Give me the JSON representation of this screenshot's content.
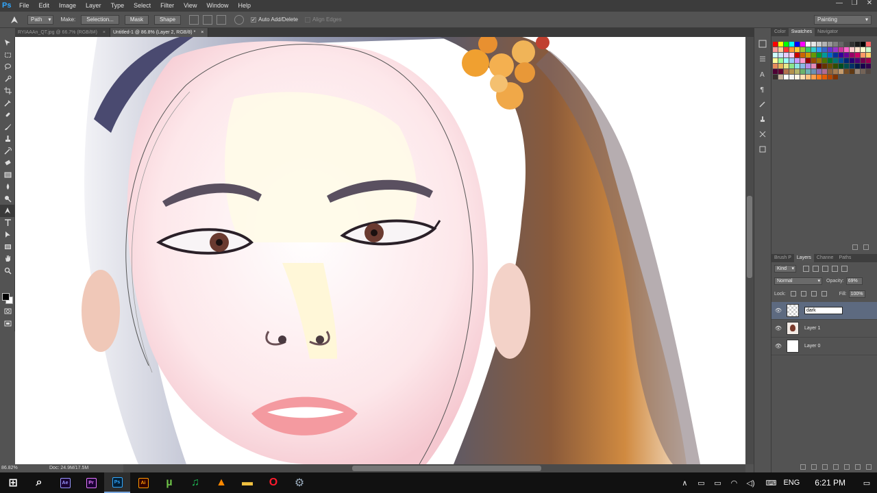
{
  "menu": {
    "logo": "Ps",
    "items": [
      "File",
      "Edit",
      "Image",
      "Layer",
      "Type",
      "Select",
      "Filter",
      "View",
      "Window",
      "Help"
    ]
  },
  "window_controls": [
    "—",
    "❐",
    "✕"
  ],
  "options": {
    "mode": "Path",
    "make_label": "Make:",
    "selection_button": "Selection...",
    "mask_button": "Mask",
    "shape_button": "Shape",
    "auto_add_delete": "Auto Add/Delete",
    "auto_add_delete_checked": true,
    "align_edges": "Align Edges",
    "workspace": "Painting"
  },
  "tabs": [
    {
      "label": "RYIAAAn_QT.jpg @ 66.7% (RGB/8#)",
      "active": false
    },
    {
      "label": "Untitled-1 @ 86.8% (Layer 2, RGB/8) *",
      "active": true
    }
  ],
  "tab_close": "×",
  "status": {
    "zoom": "86.82%",
    "doc": "Doc: 24.9M/17.5M"
  },
  "panels": {
    "top_tabs": [
      "Color",
      "Swatches",
      "Navigator"
    ],
    "top_active": "Swatches",
    "layer_tabs": [
      "Brush P",
      "Layers",
      "Channe",
      "Paths"
    ],
    "layer_active": "Layers",
    "filter_kind": "Kind",
    "blend_mode": "Normal",
    "opacity_label": "Opacity:",
    "opacity": "69%",
    "lock_label": "Lock:",
    "fill_label": "Fill:",
    "fill": "100%"
  },
  "layers": [
    {
      "name": "dark",
      "editing": true,
      "thumb": "checker",
      "selected": true
    },
    {
      "name": "Layer 1",
      "editing": false,
      "thumb": "portrait",
      "selected": false
    },
    {
      "name": "Layer 0",
      "editing": false,
      "thumb": "white",
      "selected": false
    }
  ],
  "swatch_colors": [
    "#ff0000",
    "#ffff00",
    "#00ff00",
    "#00ffff",
    "#0000ff",
    "#ff00ff",
    "#ffffff",
    "#e6e6e6",
    "#cccccc",
    "#b3b3b3",
    "#999999",
    "#808080",
    "#666666",
    "#4d4d4d",
    "#333333",
    "#1a1a1a",
    "#000000",
    "#ff6666",
    "#ff9999",
    "#ffcc99",
    "#ff3333",
    "#ff9933",
    "#ffcc33",
    "#99cc33",
    "#33cc66",
    "#33cccc",
    "#3399ff",
    "#3366cc",
    "#6633cc",
    "#9933cc",
    "#cc3399",
    "#ff66cc",
    "#ffcccc",
    "#ffe5cc",
    "#ffffcc",
    "#ccffcc",
    "#ccffff",
    "#cce5ff",
    "#e5ccff",
    "#ffccf2",
    "#cc0000",
    "#cc6600",
    "#cc9900",
    "#669900",
    "#009933",
    "#009999",
    "#0066cc",
    "#003399",
    "#330099",
    "#660099",
    "#990066",
    "#cc0066",
    "#ff9966",
    "#ffcc66",
    "#ffff99",
    "#99ff99",
    "#99ffff",
    "#99ccff",
    "#cc99ff",
    "#ff99cc",
    "#990000",
    "#994c00",
    "#997300",
    "#4d7300",
    "#00732e",
    "#007373",
    "#004d99",
    "#002673",
    "#260073",
    "#4c0073",
    "#73004d",
    "#99004d",
    "#e68a5c",
    "#e6b85c",
    "#e6e68a",
    "#8ae68a",
    "#8ae6e6",
    "#8ab8e6",
    "#b88ae6",
    "#e68ab8",
    "#660000",
    "#663300",
    "#664c00",
    "#334d00",
    "#004d1f",
    "#004d4d",
    "#003366",
    "#001a4d",
    "#1a004d",
    "#33004d",
    "#4d0033",
    "#660033",
    "#b3724d",
    "#b3904d",
    "#b3b36b",
    "#6bb36b",
    "#6bb3b3",
    "#6b90b3",
    "#906bb3",
    "#b36b90",
    "#8c6239",
    "#a67c52",
    "#c69c6d",
    "#754c24",
    "#603913",
    "#998675",
    "#736357",
    "#534741",
    "#362f2d",
    "#c7b299",
    "#ffffff",
    "#f2f2f2",
    "#fff5e6",
    "#ffe0b3",
    "#ffc280",
    "#ff9e4d",
    "#ff7a1a",
    "#e65c00",
    "#b34700",
    "#803300"
  ],
  "taskbar": {
    "apps": [
      {
        "name": "start",
        "glyph": "⊞"
      },
      {
        "name": "search",
        "glyph": "⌕"
      },
      {
        "name": "after-effects",
        "glyph": "Ae"
      },
      {
        "name": "premiere",
        "glyph": "Pr"
      },
      {
        "name": "photoshop",
        "glyph": "Ps"
      },
      {
        "name": "illustrator",
        "glyph": "Ai"
      },
      {
        "name": "utorrent",
        "glyph": "µ"
      },
      {
        "name": "spotify",
        "glyph": "♫"
      },
      {
        "name": "vlc",
        "glyph": "▲"
      },
      {
        "name": "file-explorer",
        "glyph": "▬"
      },
      {
        "name": "opera",
        "glyph": "O"
      },
      {
        "name": "steam",
        "glyph": "⚙"
      }
    ],
    "tray_icons": [
      "∧",
      "▭",
      "▭",
      "◠",
      "◁)",
      "⌨"
    ],
    "language": "ENG",
    "time": "6:21 PM",
    "notification": "▭"
  }
}
